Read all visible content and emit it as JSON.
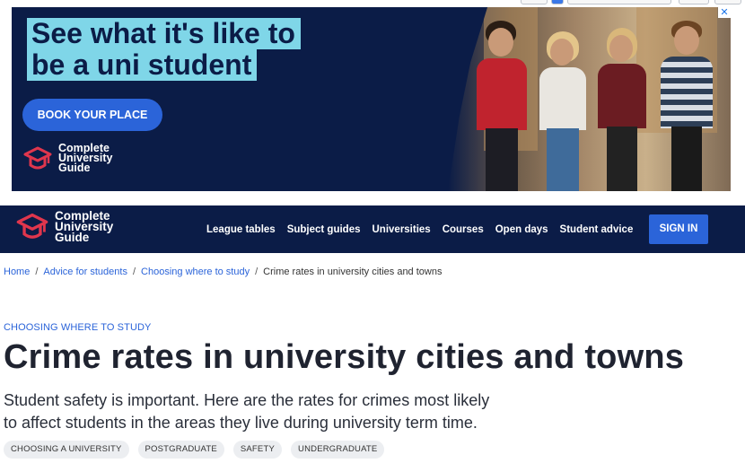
{
  "ad": {
    "headline_line1": "See what it's like to",
    "headline_line2": "be a uni student",
    "cta_label": "BOOK YOUR PLACE",
    "logo_line1": "Complete",
    "logo_line2": "University",
    "logo_line3": "Guide",
    "close_label": "✕"
  },
  "nav": {
    "logo_line1": "Complete",
    "logo_line2": "University",
    "logo_line3": "Guide",
    "links": [
      "League tables",
      "Subject guides",
      "Universities",
      "Courses",
      "Open days",
      "Student advice"
    ],
    "sign_in_label": "SIGN IN"
  },
  "breadcrumb": {
    "items": [
      "Home",
      "Advice for students",
      "Choosing where to study"
    ],
    "current": "Crime rates in university cities and towns",
    "separator": "/"
  },
  "article": {
    "kicker": "CHOOSING WHERE TO STUDY",
    "title": "Crime rates in university cities and towns",
    "lede_line1": "Student safety is important. Here are the rates for crimes most likely",
    "lede_line2": "to affect students in the areas they live during university term time.",
    "tags": [
      "CHOOSING A UNIVERSITY",
      "POSTGRADUATE",
      "SAFETY",
      "UNDERGRADUATE"
    ]
  },
  "colors": {
    "navy": "#0b1c47",
    "accent_blue": "#2b64d9",
    "highlight_cyan": "#7fd6e8",
    "logo_red": "#e0364d"
  },
  "icons": {
    "logo": "graduation-cap-icon",
    "close": "close-icon"
  }
}
